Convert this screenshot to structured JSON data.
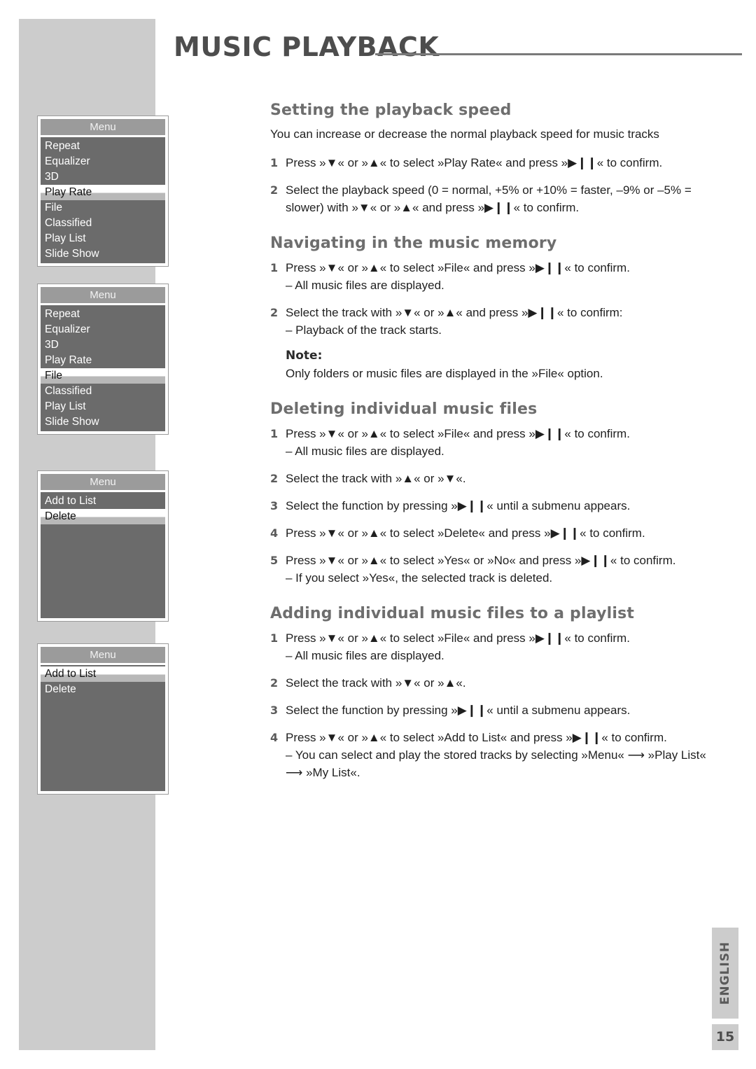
{
  "header": {
    "title": "MUSIC PLAYBACK"
  },
  "glyphs": {
    "down": "▼",
    "up": "▲",
    "playpause": "▶❙❙",
    "arrow": "⟶",
    "gl": "»",
    "gr": "«"
  },
  "osd_menus": [
    {
      "title": "Menu",
      "items": [
        {
          "label": "Repeat",
          "selected": false
        },
        {
          "label": "Equalizer",
          "selected": false
        },
        {
          "label": "3D",
          "selected": false
        },
        {
          "label": "Play Rate",
          "selected": true
        },
        {
          "label": "File",
          "selected": false
        },
        {
          "label": "Classified",
          "selected": false
        },
        {
          "label": "Play List",
          "selected": false
        },
        {
          "label": "Slide Show",
          "selected": false
        }
      ],
      "blank_rows": 0
    },
    {
      "title": "Menu",
      "items": [
        {
          "label": "Repeat",
          "selected": false
        },
        {
          "label": "Equalizer",
          "selected": false
        },
        {
          "label": "3D",
          "selected": false
        },
        {
          "label": "Play Rate",
          "selected": false
        },
        {
          "label": "File",
          "selected": true
        },
        {
          "label": "Classified",
          "selected": false
        },
        {
          "label": "Play List",
          "selected": false
        },
        {
          "label": "Slide Show",
          "selected": false
        }
      ],
      "blank_rows": 0
    },
    {
      "title": "Menu",
      "items": [
        {
          "label": "Add to List",
          "selected": false
        },
        {
          "label": "Delete",
          "selected": true
        }
      ],
      "blank_rows": 6
    },
    {
      "title": "Menu",
      "items": [
        {
          "label": "Add to List",
          "selected": true
        },
        {
          "label": "Delete",
          "selected": false
        }
      ],
      "blank_rows": 6
    }
  ],
  "sections": [
    {
      "heading": "Setting the playback speed",
      "lead": "You can increase or decrease the normal playback speed for music tracks",
      "steps": [
        {
          "num": "1",
          "text": "Press »▼« or »▲« to select »Play Rate« and press »▶❙❙« to confirm.",
          "sub": ""
        },
        {
          "num": "2",
          "text": "Select the playback speed (0 = normal, +5% or +10% = faster, –9% or –5% = slower) with »▼« or »▲« and press »▶❙❙« to confirm.",
          "sub": ""
        }
      ],
      "note_head": "",
      "note_body": ""
    },
    {
      "heading": "Navigating in the music memory",
      "lead": "",
      "steps": [
        {
          "num": "1",
          "text": "Press »▼« or »▲« to select »File« and press »▶❙❙« to confirm.",
          "sub": "– All music files are displayed."
        },
        {
          "num": "2",
          "text": "Select the track with »▼« or »▲« and press »▶❙❙« to confirm:",
          "sub": "– Playback of the track starts."
        }
      ],
      "note_head": "Note:",
      "note_body": "Only folders or music files are displayed in the »File« option."
    },
    {
      "heading": "Deleting individual music files",
      "lead": "",
      "steps": [
        {
          "num": "1",
          "text": "Press »▼« or »▲« to select »File« and press »▶❙❙« to confirm.",
          "sub": "– All music files are displayed."
        },
        {
          "num": "2",
          "text": "Select the track with »▲« or »▼«.",
          "sub": ""
        },
        {
          "num": "3",
          "text": "Select the function by pressing »▶❙❙« until a submenu appears.",
          "sub": ""
        },
        {
          "num": "4",
          "text": "Press »▼« or »▲« to select »Delete« and press »▶❙❙« to confirm.",
          "sub": ""
        },
        {
          "num": "5",
          "text": "Press »▼« or »▲« to select »Yes« or »No« and press »▶❙❙« to confirm.",
          "sub": "– If you select »Yes«, the selected track is deleted."
        }
      ],
      "note_head": "",
      "note_body": ""
    },
    {
      "heading": "Adding individual music files to a playlist",
      "lead": "",
      "steps": [
        {
          "num": "1",
          "text": "Press »▼« or »▲« to select »File« and press »▶❙❙« to confirm.",
          "sub": "– All music files are displayed."
        },
        {
          "num": "2",
          "text": "Select the track with »▼« or »▲«.",
          "sub": ""
        },
        {
          "num": "3",
          "text": "Select the function by pressing »▶❙❙« until a submenu appears.",
          "sub": ""
        },
        {
          "num": "4",
          "text": "Press »▼« or »▲« to select »Add to List« and press »▶❙❙« to confirm.",
          "sub": "– You can select and play the stored tracks by selecting »Menu« ⟶ »Play List« ⟶ »My List«."
        }
      ],
      "note_head": "",
      "note_body": ""
    }
  ],
  "footer": {
    "language": "ENGLISH",
    "page_number": "15"
  }
}
